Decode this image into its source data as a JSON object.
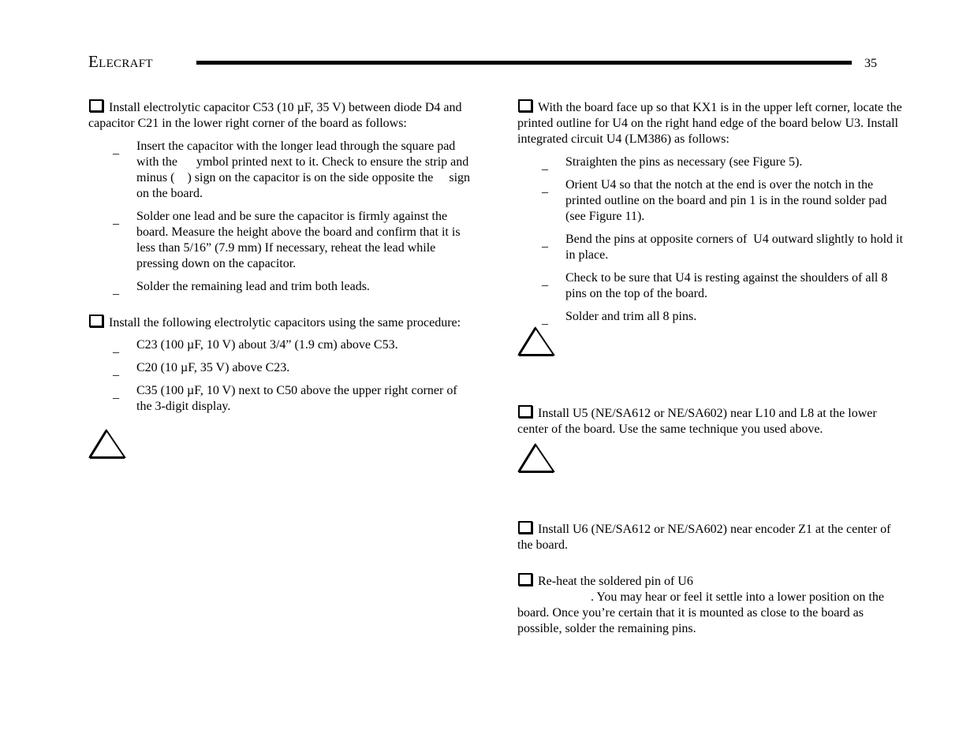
{
  "header": {
    "brand": "Elecraft",
    "page_number": "35"
  },
  "left_column": {
    "step1": {
      "text": "Install electrolytic capacitor C53 (10 µF, 35 V) between diode D4 and capacitor C21 in the lower right corner of the board as follows:",
      "substeps": [
        "Insert the capacitor with the longer lead through the square pad with the      ymbol printed next to it. Check to ensure the strip and minus (    ) sign on the capacitor is on the side opposite the     sign on the board.",
        "Solder one lead and be sure the capacitor is firmly against the board. Measure the height above the board and confirm that it is less than 5/16” (7.9 mm) If necessary, reheat the lead while pressing down on the capacitor.",
        "Solder the remaining lead and trim both leads."
      ]
    },
    "step2": {
      "text": "Install the following electrolytic capacitors using the same procedure:",
      "substeps": [
        "C23 (100 µF, 10 V) about 3/4” (1.9 cm) above C53.",
        "C20 (10 µF, 35 V) above C23.",
        "C35 (100 µF, 10 V) next to C50 above the upper right corner of the 3-digit display."
      ]
    },
    "warning_icon": "warning-triangle-icon"
  },
  "right_column": {
    "step1": {
      "text": "With the board face up so that KX1 is in the upper left corner, locate the printed outline for U4 on the right hand edge of the board below U3. Install integrated circuit U4 (LM386) as follows:",
      "substeps": [
        "Straighten the pins as necessary (see Figure 5).",
        "Orient U4 so that the notch at the end is over the notch in the printed outline on the board and pin 1 is in the round solder pad (see Figure 11).",
        "Bend the pins at opposite corners of  U4 outward slightly to hold it in place.",
        "Check to be sure that U4 is resting against the shoulders of all 8 pins on the top of the board.",
        "Solder and trim all 8 pins."
      ]
    },
    "step2": {
      "text": "Install U5 (NE/SA612 or NE/SA602) near L10 and L8 at the lower center of the board. Use the same technique you used above."
    },
    "step3": {
      "text": "Install U6 (NE/SA612 or NE/SA602) near encoder Z1 at the center of the board."
    },
    "step4": {
      "line1": "Re-heat the soldered pin of U6",
      "rest": ". You may hear or feel it settle into a lower position on the board. Once you’re certain that it is mounted as close to the board as possible, solder the remaining pins."
    }
  },
  "bullet_glyph": "_"
}
